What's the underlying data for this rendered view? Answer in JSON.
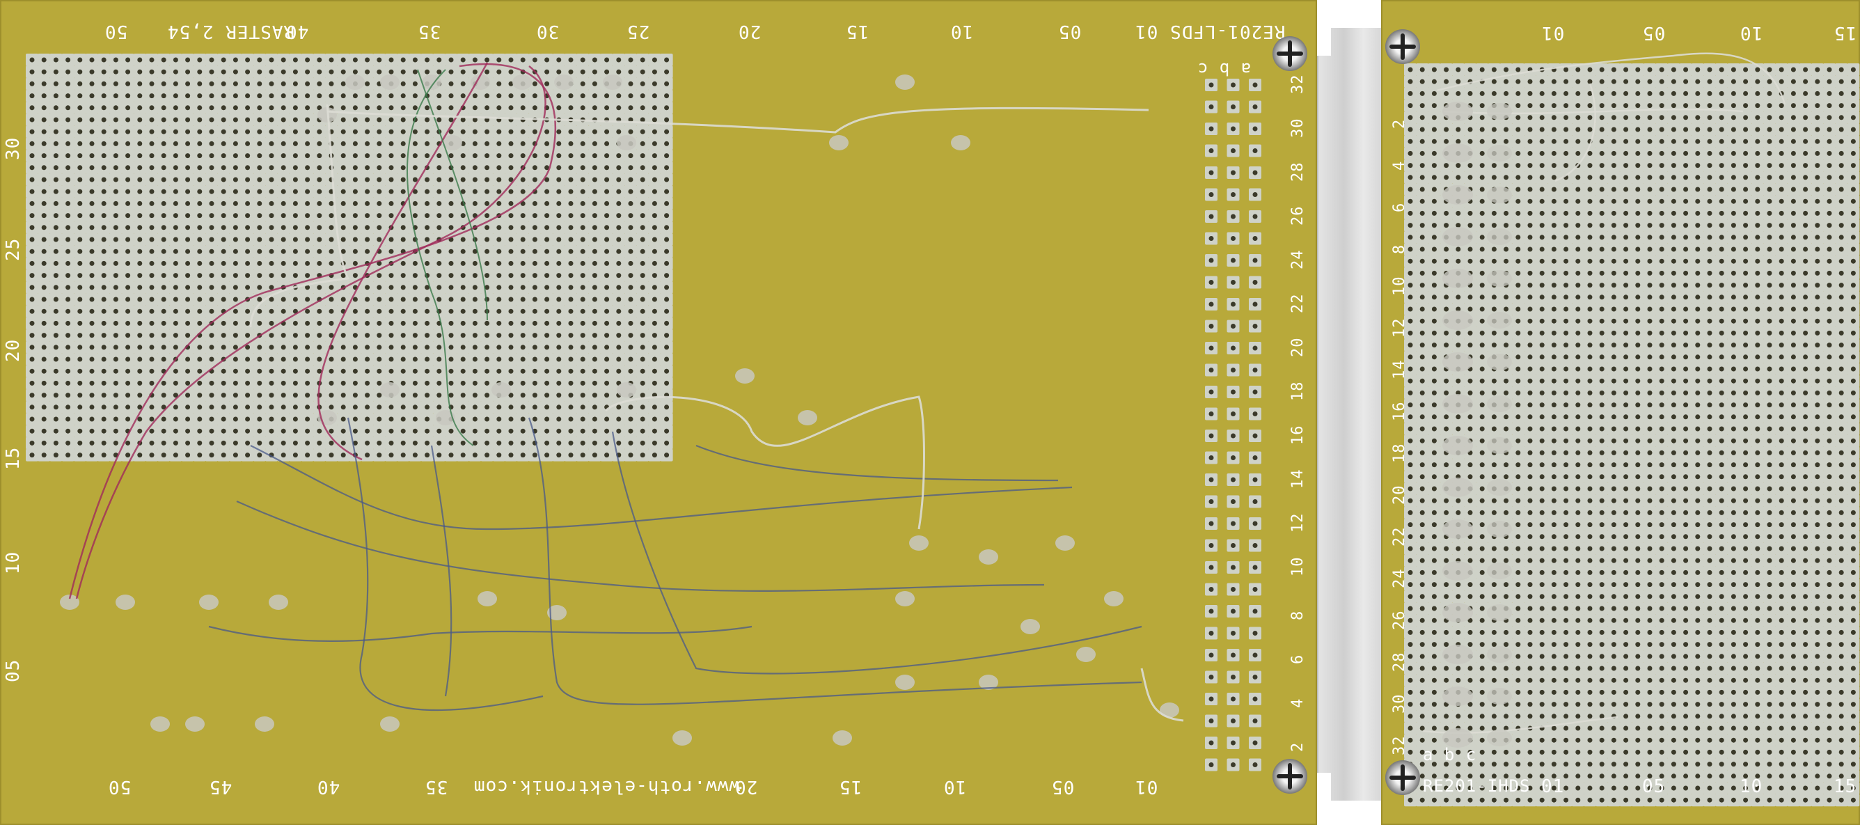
{
  "left_board": {
    "title": "RE201-LFDS",
    "raster": "RASTER 2,54",
    "website": "www.roth-elektronik.com",
    "top_numbers": [
      "50",
      "40",
      "35",
      "30",
      "25",
      "20",
      "15",
      "10",
      "05",
      "01"
    ],
    "bottom_numbers": [
      "50",
      "45",
      "40",
      "35",
      "20",
      "15",
      "10",
      "05",
      "01"
    ],
    "side_numbers": [
      "30",
      "25",
      "20",
      "15",
      "10",
      "05"
    ],
    "column_letters": "a b c",
    "connector_row_numbers": [
      "32",
      "30",
      "28",
      "26",
      "24",
      "22",
      "20",
      "18",
      "16",
      "14",
      "12",
      "10",
      "8",
      "6",
      "4",
      "2"
    ]
  },
  "right_board": {
    "title": "RE201-IHDS",
    "top_numbers": [
      "01",
      "05",
      "10",
      "15"
    ],
    "bottom_numbers": [
      "01",
      "05",
      "10",
      "15"
    ],
    "column_letters": "a b c",
    "row_numbers": [
      "2",
      "4",
      "6",
      "8",
      "10",
      "12",
      "14",
      "16",
      "18",
      "20",
      "22",
      "24",
      "26",
      "28",
      "30",
      "32"
    ]
  },
  "colors": {
    "board": "#b8a93a",
    "pad": "#cfd2c8",
    "hole": "#3b3a2a",
    "wire_red": "#a02a5a",
    "wire_blue": "#4a5a8a",
    "wire_green": "#3a7a4a",
    "solder": "#c8c8c0"
  }
}
